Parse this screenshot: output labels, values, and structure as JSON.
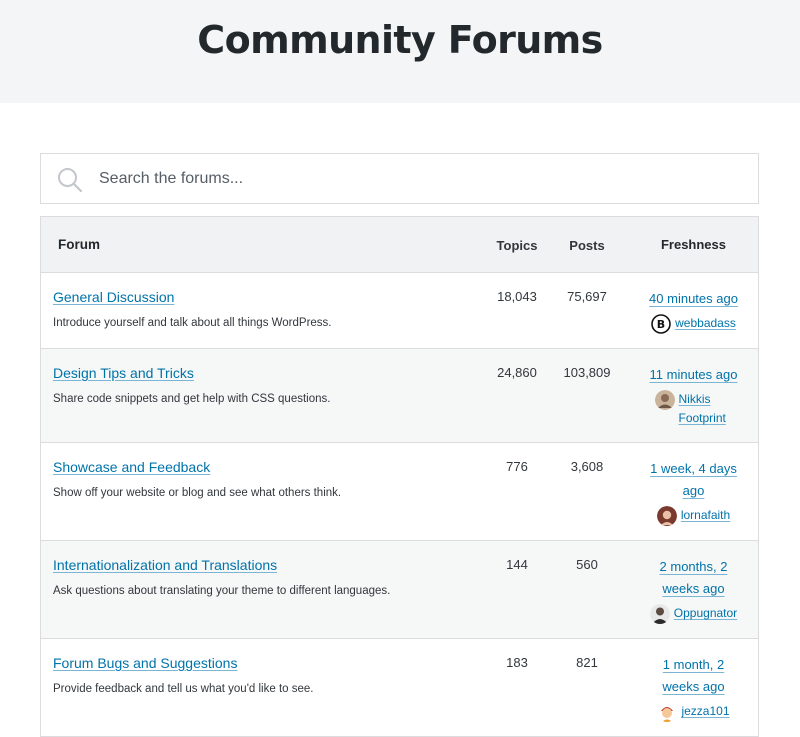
{
  "page": {
    "title": "Community Forums"
  },
  "search": {
    "placeholder": "Search the forums...",
    "value": "",
    "icon": "search-icon"
  },
  "table": {
    "headers": {
      "forum": "Forum",
      "topics": "Topics",
      "posts": "Posts",
      "freshness": "Freshness"
    },
    "rows": [
      {
        "title": "General Discussion",
        "description": "Introduce yourself and talk about all things WordPress.",
        "topics": "18,043",
        "posts": "75,697",
        "freshness": "40 minutes ago",
        "author": "webbadass"
      },
      {
        "title": "Design Tips and Tricks",
        "description": "Share code snippets and get help with CSS questions.",
        "topics": "24,860",
        "posts": "103,809",
        "freshness": "11 minutes ago",
        "author": "Nikkis Footprint"
      },
      {
        "title": "Showcase and Feedback",
        "description": "Show off your website or blog and see what others think.",
        "topics": "776",
        "posts": "3,608",
        "freshness": "1 week, 4 days ago",
        "author": "lornafaith"
      },
      {
        "title": "Internationalization and Translations",
        "description": "Ask questions about translating your theme to different languages.",
        "topics": "144",
        "posts": "560",
        "freshness": "2 months, 2 weeks ago",
        "author": "Oppugnator"
      },
      {
        "title": "Forum Bugs and Suggestions",
        "description": "Provide feedback and tell us what you'd like to see.",
        "topics": "183",
        "posts": "821",
        "freshness": "1 month, 2 weeks ago",
        "author": "jezza101"
      }
    ]
  },
  "colors": {
    "link": "#0073aa",
    "hero_bg": "#f3f5f7",
    "border": "#dcdcde",
    "header_bg": "#f1f2f3"
  }
}
